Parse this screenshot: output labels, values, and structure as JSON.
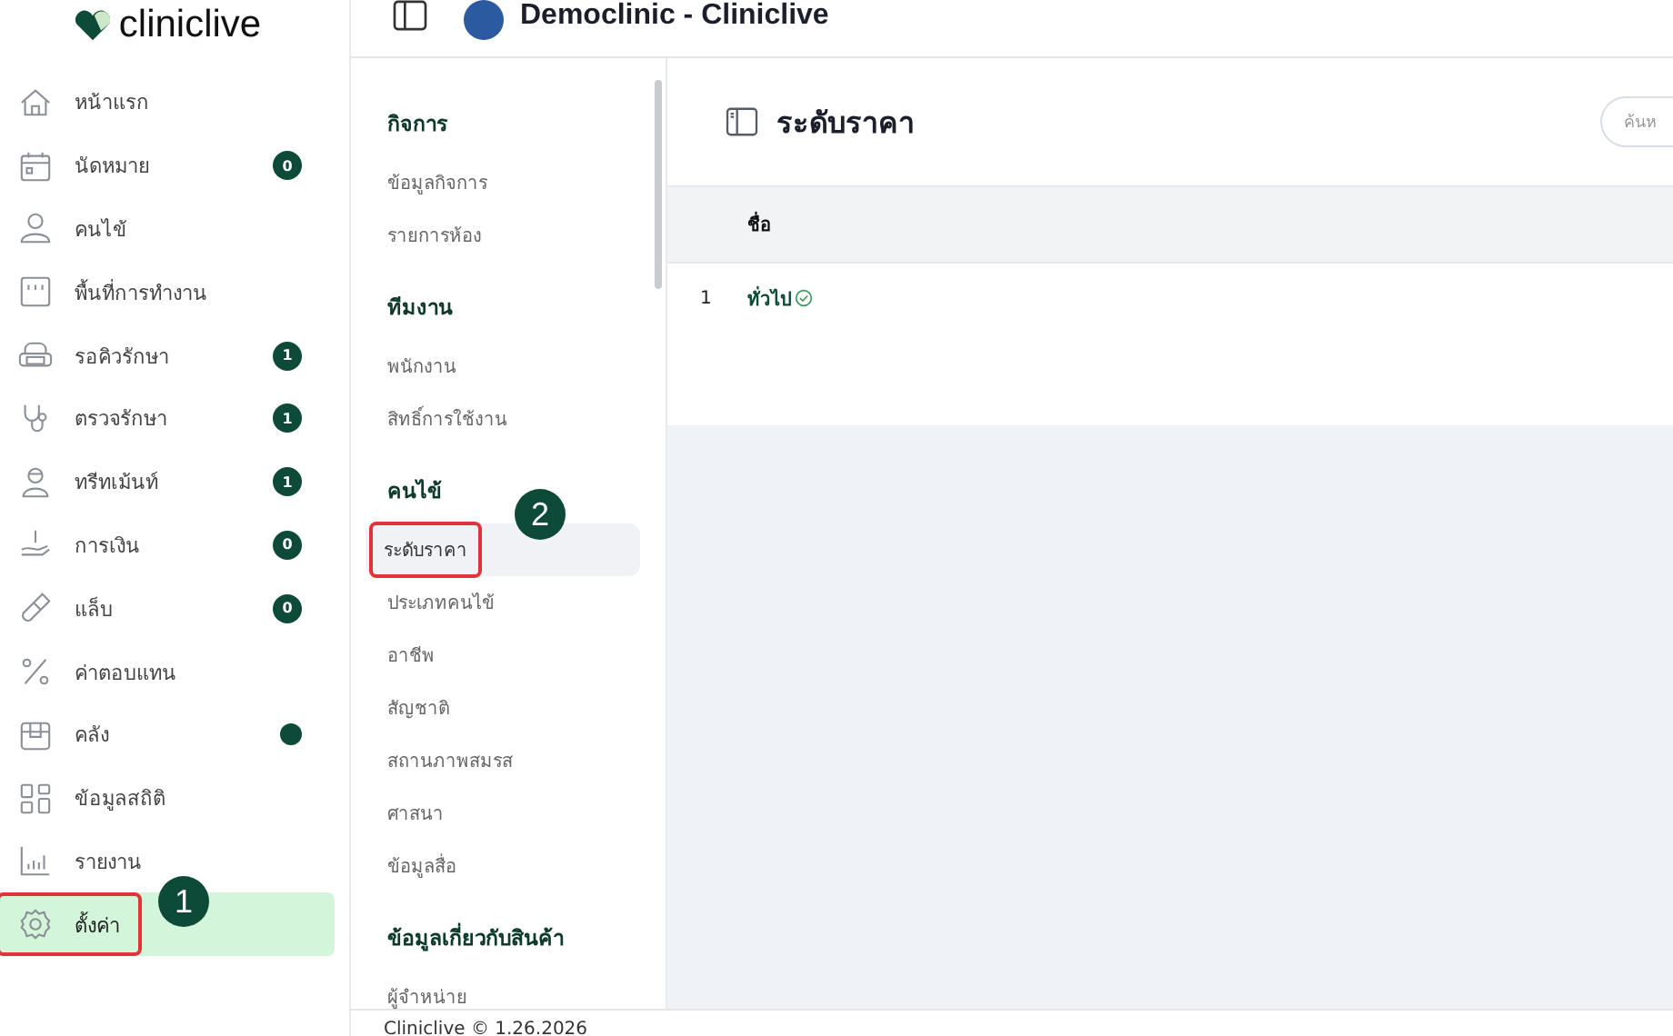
{
  "brand": {
    "name": "cliniclive"
  },
  "header": {
    "title": "Democlinic - Cliniclive"
  },
  "sidebar": {
    "items": [
      {
        "label": "หน้าแรก",
        "selected": false,
        "highlighted": false
      },
      {
        "label": "นัดหมาย",
        "badge": "0",
        "selected": false,
        "highlighted": false
      },
      {
        "label": "คนไข้",
        "selected": false,
        "highlighted": false
      },
      {
        "label": "พื้นที่การทำงาน",
        "selected": false,
        "highlighted": false
      },
      {
        "label": "รอคิวรักษา",
        "badge": "1",
        "selected": false,
        "highlighted": false
      },
      {
        "label": "ตรวจรักษา",
        "badge": "1",
        "selected": false,
        "highlighted": false
      },
      {
        "label": "ทรีทเม้นท์",
        "badge": "1",
        "selected": false,
        "highlighted": false
      },
      {
        "label": "การเงิน",
        "badge": "0",
        "selected": false,
        "highlighted": false
      },
      {
        "label": "แล็บ",
        "badge": "0",
        "selected": false,
        "highlighted": false
      },
      {
        "label": "ค่าตอบแทน",
        "selected": false,
        "highlighted": false
      },
      {
        "label": "คลัง",
        "dot": true,
        "selected": false,
        "highlighted": false
      },
      {
        "label": "ข้อมูลสถิติ",
        "selected": false,
        "highlighted": false
      },
      {
        "label": "รายงาน",
        "selected": false,
        "highlighted": false
      },
      {
        "label": "ตั้งค่า",
        "selected": true,
        "highlighted": true,
        "callout": "1"
      }
    ]
  },
  "settings_nav": {
    "sections": [
      {
        "title": "กิจการ",
        "items": [
          {
            "label": "ข้อมูลกิจการ",
            "selected": false,
            "highlighted": false
          },
          {
            "label": "รายการห้อง",
            "selected": false,
            "highlighted": false
          }
        ]
      },
      {
        "title": "ทีมงาน",
        "items": [
          {
            "label": "พนักงาน",
            "selected": false,
            "highlighted": false
          },
          {
            "label": "สิทธิ์การใช้งาน",
            "selected": false,
            "highlighted": false
          }
        ]
      },
      {
        "title": "คนไข้",
        "items": [
          {
            "label": "ระดับราคา",
            "selected": true,
            "highlighted": true,
            "callout": "2"
          },
          {
            "label": "ประเภทคนไข้",
            "selected": false,
            "highlighted": false
          },
          {
            "label": "อาชีพ",
            "selected": false,
            "highlighted": false
          },
          {
            "label": "สัญชาติ",
            "selected": false,
            "highlighted": false
          },
          {
            "label": "สถานภาพสมรส",
            "selected": false,
            "highlighted": false
          },
          {
            "label": "ศาสนา",
            "selected": false,
            "highlighted": false
          },
          {
            "label": "ข้อมูลสื่อ",
            "selected": false,
            "highlighted": false
          }
        ]
      },
      {
        "title": "ข้อมูลเกี่ยวกับสินค้า",
        "items": [
          {
            "label": "ผู้จำหน่าย",
            "selected": false,
            "highlighted": false
          }
        ]
      }
    ]
  },
  "page": {
    "title": "ระดับราคา",
    "search": {
      "placeholder": "ค้นห"
    },
    "table": {
      "columns": [
        "ชื่อ"
      ],
      "rows": [
        {
          "index": "1",
          "name": "ทั่วไป",
          "verified": true
        }
      ]
    }
  },
  "footer": {
    "text": "Cliniclive © 1.26.2026"
  }
}
